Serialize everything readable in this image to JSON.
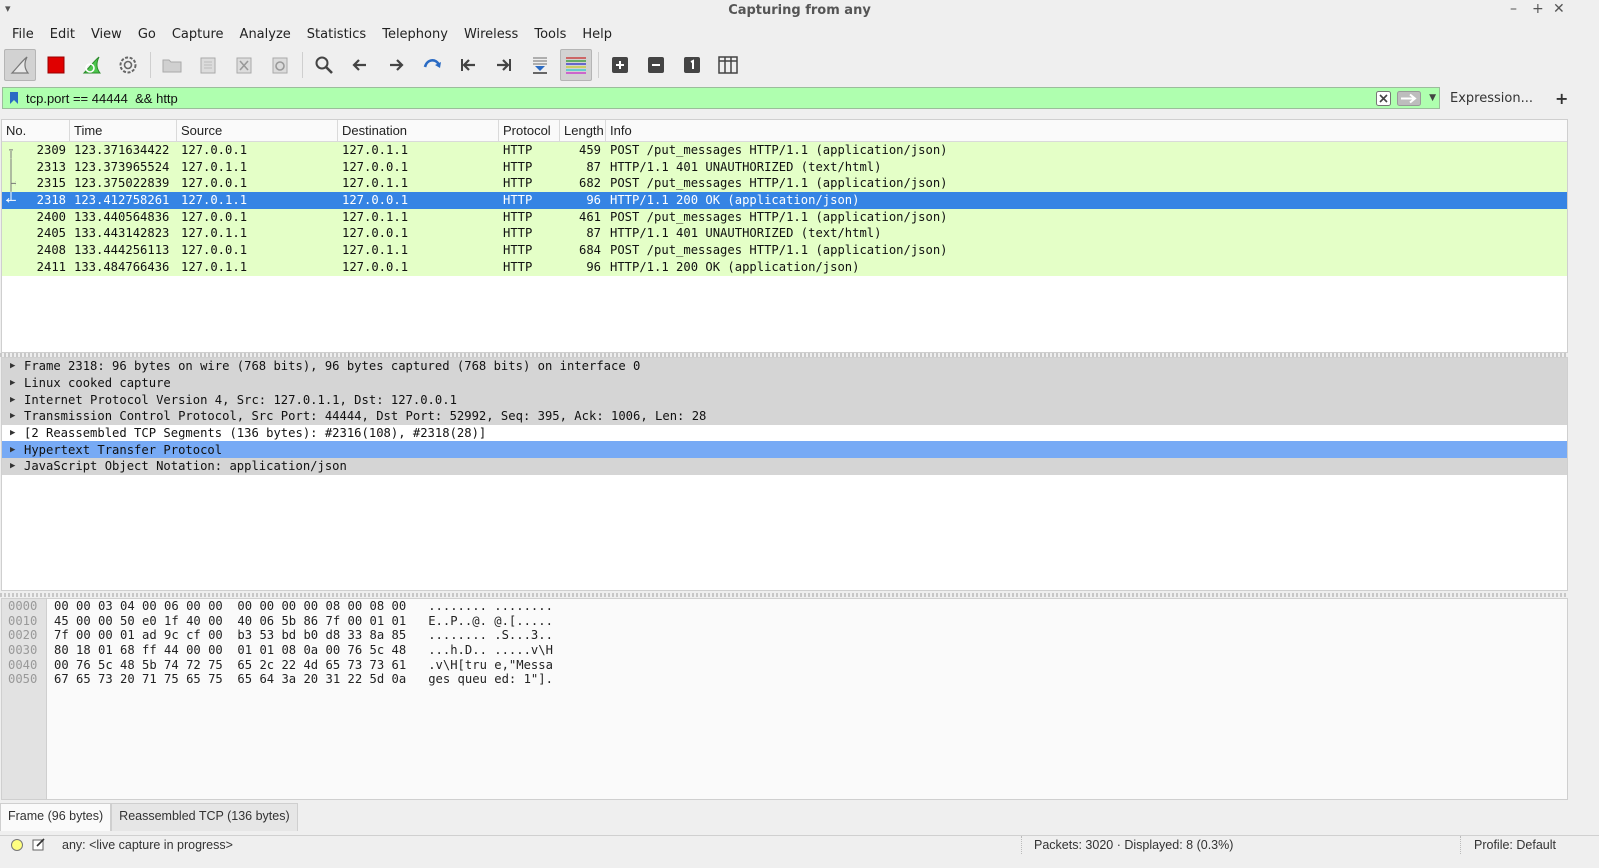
{
  "window": {
    "title": "Capturing from any",
    "menu_glyph": "▾",
    "minimize": "–",
    "maximize": "+",
    "close": "✕"
  },
  "menubar": [
    "File",
    "Edit",
    "View",
    "Go",
    "Capture",
    "Analyze",
    "Statistics",
    "Telephony",
    "Wireless",
    "Tools",
    "Help"
  ],
  "filter": {
    "value": "tcp.port == 44444  && http",
    "expression_label": "Expression...",
    "add_label": "+",
    "bg": "#afffaf"
  },
  "columns": [
    "No.",
    "Time",
    "Source",
    "Destination",
    "Protocol",
    "Length",
    "Info"
  ],
  "packets": [
    {
      "no": "2309",
      "time": "123.371634422",
      "src": "127.0.0.1",
      "dst": "127.0.1.1",
      "proto": "HTTP",
      "len": "459",
      "info": "POST /put_messages HTTP/1.1  (application/json)"
    },
    {
      "no": "2313",
      "time": "123.373965524",
      "src": "127.0.1.1",
      "dst": "127.0.0.1",
      "proto": "HTTP",
      "len": "87",
      "info": "HTTP/1.1 401 UNAUTHORIZED  (text/html)"
    },
    {
      "no": "2315",
      "time": "123.375022839",
      "src": "127.0.0.1",
      "dst": "127.0.1.1",
      "proto": "HTTP",
      "len": "682",
      "info": "POST /put_messages HTTP/1.1  (application/json)"
    },
    {
      "no": "2318",
      "time": "123.412758261",
      "src": "127.0.1.1",
      "dst": "127.0.0.1",
      "proto": "HTTP",
      "len": "96",
      "info": "HTTP/1.1 200 OK  (application/json)"
    },
    {
      "no": "2400",
      "time": "133.440564836",
      "src": "127.0.0.1",
      "dst": "127.0.1.1",
      "proto": "HTTP",
      "len": "461",
      "info": "POST /put_messages HTTP/1.1  (application/json)"
    },
    {
      "no": "2405",
      "time": "133.443142823",
      "src": "127.0.1.1",
      "dst": "127.0.0.1",
      "proto": "HTTP",
      "len": "87",
      "info": "HTTP/1.1 401 UNAUTHORIZED  (text/html)"
    },
    {
      "no": "2408",
      "time": "133.444256113",
      "src": "127.0.0.1",
      "dst": "127.0.1.1",
      "proto": "HTTP",
      "len": "684",
      "info": "POST /put_messages HTTP/1.1  (application/json)"
    },
    {
      "no": "2411",
      "time": "133.484766436",
      "src": "127.0.1.1",
      "dst": "127.0.0.1",
      "proto": "HTTP",
      "len": "96",
      "info": "HTTP/1.1 200 OK  (application/json)"
    }
  ],
  "details": [
    "Frame 2318: 96 bytes on wire (768 bits), 96 bytes captured (768 bits) on interface 0",
    "Linux cooked capture",
    "Internet Protocol Version 4, Src: 127.0.1.1, Dst: 127.0.0.1",
    "Transmission Control Protocol, Src Port: 44444, Dst Port: 52992, Seq: 395, Ack: 1006, Len: 28",
    "[2 Reassembled TCP Segments (136 bytes): #2316(108), #2318(28)]",
    "Hypertext Transfer Protocol",
    "JavaScript Object Notation: application/json"
  ],
  "bytes": {
    "offsets": [
      "0000",
      "0010",
      "0020",
      "0030",
      "0040",
      "0050"
    ],
    "lines": [
      "00 00 03 04 00 06 00 00  00 00 00 00 08 00 08 00   ........ ........",
      "45 00 00 50 e0 1f 40 00  40 06 5b 86 7f 00 01 01   E..P..@. @.[.....",
      "7f 00 00 01 ad 9c cf 00  b3 53 bd b0 d8 33 8a 85   ........ .S...3..",
      "80 18 01 68 ff 44 00 00  01 01 08 0a 00 76 5c 48   ...h.D.. .....v\\H",
      "00 76 5c 48 5b 74 72 75  65 2c 22 4d 65 73 73 61   .v\\H[tru e,\"Messa",
      "67 65 73 20 71 75 65 75  65 64 3a 20 31 22 5d 0a   ges queu ed: 1\"]."
    ]
  },
  "byte_tabs": [
    "Frame (96 bytes)",
    "Reassembled TCP (136 bytes)"
  ],
  "status": {
    "capture": "any: <live capture in progress>",
    "packets": "Packets: 3020 · Displayed: 8 (0.3%)",
    "profile": "Profile: Default"
  }
}
